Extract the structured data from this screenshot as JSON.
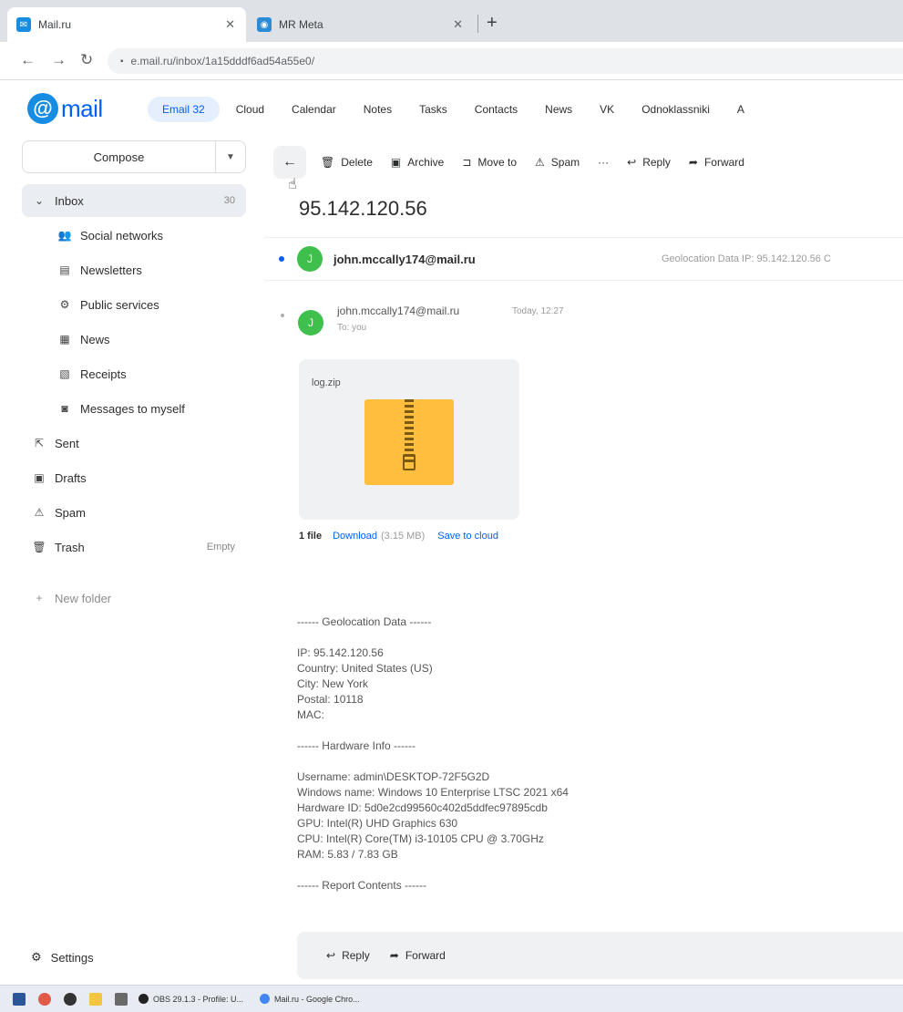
{
  "browser": {
    "tabs": [
      {
        "title": "Mail.ru",
        "active": true
      },
      {
        "title": "MR Meta",
        "active": false
      }
    ],
    "url": "e.mail.ru/inbox/1a15dddf6ad54a55e0/"
  },
  "header": {
    "logo": "mail",
    "nav": [
      {
        "label": "Email 32",
        "active": true
      },
      {
        "label": "Cloud"
      },
      {
        "label": "Calendar"
      },
      {
        "label": "Notes"
      },
      {
        "label": "Tasks"
      },
      {
        "label": "Contacts"
      },
      {
        "label": "News"
      },
      {
        "label": "VK"
      },
      {
        "label": "Odnoklassniki"
      },
      {
        "label": "A"
      }
    ]
  },
  "sidebar": {
    "compose_label": "Compose",
    "inbox": {
      "label": "Inbox",
      "count": "30"
    },
    "subfolders": [
      {
        "label": "Social networks",
        "icon": "people-icon"
      },
      {
        "label": "Newsletters",
        "icon": "newsletter-icon"
      },
      {
        "label": "Public services",
        "icon": "public-services-icon"
      },
      {
        "label": "News",
        "icon": "news-icon"
      },
      {
        "label": "Receipts",
        "icon": "receipt-icon"
      },
      {
        "label": "Messages to myself",
        "icon": "camera-icon"
      }
    ],
    "folders": [
      {
        "label": "Sent",
        "icon": "sent-icon"
      },
      {
        "label": "Drafts",
        "icon": "drafts-icon"
      },
      {
        "label": "Spam",
        "icon": "spam-icon"
      },
      {
        "label": "Trash",
        "icon": "trash-icon",
        "action": "Empty"
      }
    ],
    "new_folder": "New folder",
    "settings": "Settings"
  },
  "toolbar": {
    "delete": "Delete",
    "archive": "Archive",
    "move_to": "Move to",
    "spam": "Spam",
    "more": "···",
    "reply": "Reply",
    "forward": "Forward"
  },
  "message": {
    "subject": "95.142.120.56",
    "thread_from": "john.mccally174@mail.ru",
    "thread_preview": "Geolocation Data IP: 95.142.120.56 C",
    "avatar_letter": "J",
    "sender": "john.mccally174@mail.ru",
    "time": "Today, 12:27",
    "to": "To: you",
    "attachment": {
      "name": "log.zip",
      "count": "1 file",
      "download": "Download",
      "size": "(3.15 MB)",
      "save": "Save to cloud"
    },
    "body": "------ Geolocation Data ------\n\nIP: 95.142.120.56\nCountry: United States (US)\nCity: New York\nPostal: 10118\nMAC:\n\n------ Hardware Info ------\n\nUsername: admin\\DESKTOP-72F5G2D\nWindows name: Windows 10 Enterprise LTSC 2021 x64\nHardware ID: 5d0e2cd99560c402d5ddfec97895cdb\nGPU: Intel(R) UHD Graphics 630\nCPU: Intel(R) Core(TM) i3-10105 CPU @ 3.70GHz\nRAM: 5.83 / 7.83 GB\n\n------ Report Contents ------"
  },
  "reply_bar": {
    "reply": "Reply",
    "forward": "Forward"
  },
  "taskbar": {
    "windows": [
      {
        "label": "OBS 29.1.3 - Profile: U..."
      },
      {
        "label": "Mail.ru - Google Chro..."
      }
    ]
  },
  "colors": {
    "accent": "#005ff9",
    "avatar": "#3fbf4b",
    "zip": "#ffbe3d"
  }
}
